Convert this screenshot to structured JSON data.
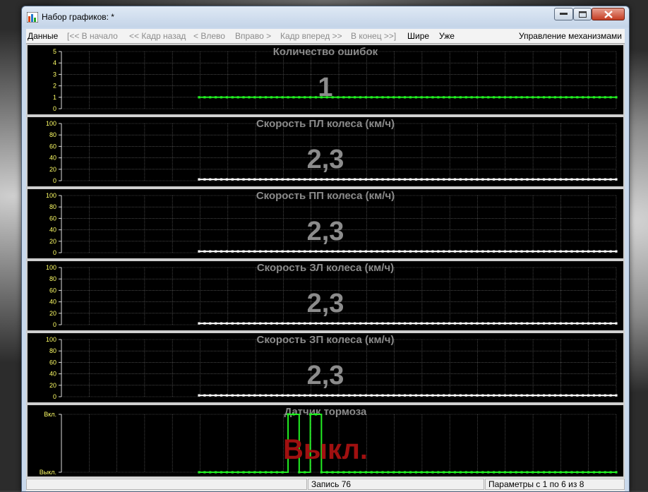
{
  "window": {
    "title": "Набор графиков: *"
  },
  "menu": {
    "items": [
      {
        "label": "Данные",
        "enabled": true
      },
      {
        "label": "[<< В начало",
        "enabled": false
      },
      {
        "label": "<< Кадр назад",
        "enabled": false
      },
      {
        "label": "< Влево",
        "enabled": false
      },
      {
        "label": "Вправо >",
        "enabled": false
      },
      {
        "label": "Кадр вперед >>",
        "enabled": false
      },
      {
        "label": "В конец >>]",
        "enabled": false
      },
      {
        "label": "Шире",
        "enabled": true
      },
      {
        "label": "Уже",
        "enabled": true
      }
    ],
    "right_item": "Управление механизмами"
  },
  "colors": {
    "axis_label": "#ffff66",
    "grid": "#707070",
    "title": "#8a8a8a",
    "value": "#8c8c8c",
    "value_alert": "#a01010",
    "green": "#22ee22",
    "white": "#ffffff"
  },
  "chart_data": [
    {
      "type": "line",
      "title": "Количество ошибок",
      "current_value": "1",
      "yticks": [
        "5",
        "4",
        "3",
        "2",
        "1",
        "0"
      ],
      "ylim": [
        0,
        5
      ],
      "x": [
        0,
        1,
        2,
        3,
        4,
        5,
        6,
        7,
        8,
        9,
        10,
        11,
        12,
        13,
        14,
        15,
        16,
        17,
        18,
        19,
        20,
        21,
        22,
        23,
        24,
        25,
        26,
        27,
        28,
        29,
        30,
        31,
        32,
        33,
        34,
        35,
        36,
        37,
        38,
        39,
        40,
        41,
        42,
        43,
        44,
        45,
        46,
        47,
        48,
        49,
        50,
        51,
        52,
        53,
        54,
        55,
        56,
        57,
        58,
        59,
        60,
        61,
        62,
        63,
        64,
        65,
        66,
        67,
        68,
        69,
        70,
        71,
        72,
        73,
        74,
        75
      ],
      "series": [
        {
          "color": "#22ee22",
          "values": [
            1,
            1,
            1,
            1,
            1,
            1,
            1,
            1,
            1,
            1,
            1,
            1,
            1,
            1,
            1,
            1,
            1,
            1,
            1,
            1,
            1,
            1,
            1,
            1,
            1,
            1,
            1,
            1,
            1,
            1,
            1,
            1,
            1,
            1,
            1,
            1,
            1,
            1,
            1,
            1,
            1,
            1,
            1,
            1,
            1,
            1,
            1,
            1,
            1,
            1,
            1,
            1,
            1,
            1,
            1,
            1,
            1,
            1,
            1,
            1,
            1,
            1,
            1,
            1,
            1,
            1,
            1,
            1,
            1,
            1,
            1,
            1,
            1,
            1,
            1,
            1
          ]
        }
      ]
    },
    {
      "type": "line",
      "title": "Скорость ПЛ колеса  (км/ч)",
      "current_value": "2,3",
      "yticks": [
        "100",
        "80",
        "60",
        "40",
        "20",
        "0"
      ],
      "ylim": [
        0,
        100
      ],
      "x": [
        0,
        1,
        2,
        3,
        4,
        5,
        6,
        7,
        8,
        9,
        10,
        11,
        12,
        13,
        14,
        15,
        16,
        17,
        18,
        19,
        20,
        21,
        22,
        23,
        24,
        25,
        26,
        27,
        28,
        29,
        30,
        31,
        32,
        33,
        34,
        35,
        36,
        37,
        38,
        39,
        40,
        41,
        42,
        43,
        44,
        45,
        46,
        47,
        48,
        49,
        50,
        51,
        52,
        53,
        54,
        55,
        56,
        57,
        58,
        59,
        60,
        61,
        62,
        63,
        64,
        65,
        66,
        67,
        68,
        69,
        70,
        71,
        72,
        73,
        74,
        75
      ],
      "series": [
        {
          "color": "#ffffff",
          "values": [
            2.3,
            2.3,
            2.3,
            2.3,
            2.3,
            2.3,
            2.3,
            2.3,
            2.3,
            2.3,
            2.3,
            2.3,
            2.3,
            2.3,
            2.3,
            2.3,
            2.3,
            2.3,
            2.3,
            2.3,
            2.3,
            2.3,
            2.3,
            2.3,
            2.3,
            2.3,
            2.3,
            2.3,
            2.3,
            2.3,
            2.3,
            2.3,
            2.3,
            2.3,
            2.3,
            2.3,
            2.3,
            2.3,
            2.3,
            2.3,
            2.3,
            2.3,
            2.3,
            2.3,
            2.3,
            2.3,
            2.3,
            2.3,
            2.3,
            2.3,
            2.3,
            2.3,
            2.3,
            2.3,
            2.3,
            2.3,
            2.3,
            2.3,
            2.3,
            2.3,
            2.3,
            2.3,
            2.3,
            2.3,
            2.3,
            2.3,
            2.3,
            2.3,
            2.3,
            2.3,
            2.3,
            2.3,
            2.3,
            2.3,
            2.3,
            2.3
          ]
        }
      ]
    },
    {
      "type": "line",
      "title": "Скорость ПП колеса  (км/ч)",
      "current_value": "2,3",
      "yticks": [
        "100",
        "80",
        "60",
        "40",
        "20",
        "0"
      ],
      "ylim": [
        0,
        100
      ],
      "x": [
        0,
        1,
        2,
        3,
        4,
        5,
        6,
        7,
        8,
        9,
        10,
        11,
        12,
        13,
        14,
        15,
        16,
        17,
        18,
        19,
        20,
        21,
        22,
        23,
        24,
        25,
        26,
        27,
        28,
        29,
        30,
        31,
        32,
        33,
        34,
        35,
        36,
        37,
        38,
        39,
        40,
        41,
        42,
        43,
        44,
        45,
        46,
        47,
        48,
        49,
        50,
        51,
        52,
        53,
        54,
        55,
        56,
        57,
        58,
        59,
        60,
        61,
        62,
        63,
        64,
        65,
        66,
        67,
        68,
        69,
        70,
        71,
        72,
        73,
        74,
        75
      ],
      "series": [
        {
          "color": "#ffffff",
          "values": [
            2.3,
            2.3,
            2.3,
            2.3,
            2.3,
            2.3,
            2.3,
            2.3,
            2.3,
            2.3,
            2.3,
            2.3,
            2.3,
            2.3,
            2.3,
            2.3,
            2.3,
            2.3,
            2.3,
            2.3,
            2.3,
            2.3,
            2.3,
            2.3,
            2.3,
            2.3,
            2.3,
            2.3,
            2.3,
            2.3,
            2.3,
            2.3,
            2.3,
            2.3,
            2.3,
            2.3,
            2.3,
            2.3,
            2.3,
            2.3,
            2.3,
            2.3,
            2.3,
            2.3,
            2.3,
            2.3,
            2.3,
            2.3,
            2.3,
            2.3,
            2.3,
            2.3,
            2.3,
            2.3,
            2.3,
            2.3,
            2.3,
            2.3,
            2.3,
            2.3,
            2.3,
            2.3,
            2.3,
            2.3,
            2.3,
            2.3,
            2.3,
            2.3,
            2.3,
            2.3,
            2.3,
            2.3,
            2.3,
            2.3,
            2.3,
            2.3
          ]
        }
      ]
    },
    {
      "type": "line",
      "title": "Скорость ЗЛ колеса  (км/ч)",
      "current_value": "2,3",
      "yticks": [
        "100",
        "80",
        "60",
        "40",
        "20",
        "0"
      ],
      "ylim": [
        0,
        100
      ],
      "x": [
        0,
        1,
        2,
        3,
        4,
        5,
        6,
        7,
        8,
        9,
        10,
        11,
        12,
        13,
        14,
        15,
        16,
        17,
        18,
        19,
        20,
        21,
        22,
        23,
        24,
        25,
        26,
        27,
        28,
        29,
        30,
        31,
        32,
        33,
        34,
        35,
        36,
        37,
        38,
        39,
        40,
        41,
        42,
        43,
        44,
        45,
        46,
        47,
        48,
        49,
        50,
        51,
        52,
        53,
        54,
        55,
        56,
        57,
        58,
        59,
        60,
        61,
        62,
        63,
        64,
        65,
        66,
        67,
        68,
        69,
        70,
        71,
        72,
        73,
        74,
        75
      ],
      "series": [
        {
          "color": "#ffffff",
          "values": [
            2.3,
            2.3,
            2.3,
            2.3,
            2.3,
            2.3,
            2.3,
            2.3,
            2.3,
            2.3,
            2.3,
            2.3,
            2.3,
            2.3,
            2.3,
            2.3,
            2.3,
            2.3,
            2.3,
            2.3,
            2.3,
            2.3,
            2.3,
            2.3,
            2.3,
            2.3,
            2.3,
            2.3,
            2.3,
            2.3,
            2.3,
            2.3,
            2.3,
            2.3,
            2.3,
            2.3,
            2.3,
            2.3,
            2.3,
            2.3,
            2.3,
            2.3,
            2.3,
            2.3,
            2.3,
            2.3,
            2.3,
            2.3,
            2.3,
            2.3,
            2.3,
            2.3,
            2.3,
            2.3,
            2.3,
            2.3,
            2.3,
            2.3,
            2.3,
            2.3,
            2.3,
            2.3,
            2.3,
            2.3,
            2.3,
            2.3,
            2.3,
            2.3,
            2.3,
            2.3,
            2.3,
            2.3,
            2.3,
            2.3,
            2.3,
            2.3
          ]
        }
      ]
    },
    {
      "type": "line",
      "title": "Скорость ЗП колеса  (км/ч)",
      "current_value": "2,3",
      "yticks": [
        "100",
        "80",
        "60",
        "40",
        "20",
        "0"
      ],
      "ylim": [
        0,
        100
      ],
      "x": [
        0,
        1,
        2,
        3,
        4,
        5,
        6,
        7,
        8,
        9,
        10,
        11,
        12,
        13,
        14,
        15,
        16,
        17,
        18,
        19,
        20,
        21,
        22,
        23,
        24,
        25,
        26,
        27,
        28,
        29,
        30,
        31,
        32,
        33,
        34,
        35,
        36,
        37,
        38,
        39,
        40,
        41,
        42,
        43,
        44,
        45,
        46,
        47,
        48,
        49,
        50,
        51,
        52,
        53,
        54,
        55,
        56,
        57,
        58,
        59,
        60,
        61,
        62,
        63,
        64,
        65,
        66,
        67,
        68,
        69,
        70,
        71,
        72,
        73,
        74,
        75
      ],
      "series": [
        {
          "color": "#ffffff",
          "values": [
            2.3,
            2.3,
            2.3,
            2.3,
            2.3,
            2.3,
            2.3,
            2.3,
            2.3,
            2.3,
            2.3,
            2.3,
            2.3,
            2.3,
            2.3,
            2.3,
            2.3,
            2.3,
            2.3,
            2.3,
            2.3,
            2.3,
            2.3,
            2.3,
            2.3,
            2.3,
            2.3,
            2.3,
            2.3,
            2.3,
            2.3,
            2.3,
            2.3,
            2.3,
            2.3,
            2.3,
            2.3,
            2.3,
            2.3,
            2.3,
            2.3,
            2.3,
            2.3,
            2.3,
            2.3,
            2.3,
            2.3,
            2.3,
            2.3,
            2.3,
            2.3,
            2.3,
            2.3,
            2.3,
            2.3,
            2.3,
            2.3,
            2.3,
            2.3,
            2.3,
            2.3,
            2.3,
            2.3,
            2.3,
            2.3,
            2.3,
            2.3,
            2.3,
            2.3,
            2.3,
            2.3,
            2.3,
            2.3,
            2.3,
            2.3,
            2.3
          ]
        }
      ]
    },
    {
      "type": "line",
      "step": true,
      "title": "Датчик тормоза",
      "current_value": "Выкл.",
      "current_value_alert": true,
      "yticks": [
        "Вкл.",
        "Выкл."
      ],
      "ylim": [
        0,
        1
      ],
      "x": [
        0,
        1,
        2,
        3,
        4,
        5,
        6,
        7,
        8,
        9,
        10,
        11,
        12,
        13,
        14,
        15,
        16,
        17,
        18,
        19,
        20,
        21,
        22,
        23,
        24,
        25,
        26,
        27,
        28,
        29,
        30,
        31,
        32,
        33,
        34,
        35,
        36,
        37,
        38,
        39,
        40,
        41,
        42,
        43,
        44,
        45,
        46,
        47,
        48,
        49,
        50,
        51,
        52,
        53,
        54,
        55,
        56,
        57,
        58,
        59,
        60,
        61,
        62,
        63,
        64,
        65,
        66,
        67,
        68,
        69,
        70,
        71,
        72,
        73,
        74,
        75
      ],
      "series": [
        {
          "color": "#22ee22",
          "values": [
            0,
            0,
            0,
            0,
            0,
            0,
            0,
            0,
            0,
            0,
            0,
            0,
            0,
            0,
            0,
            0,
            1,
            1,
            0,
            0,
            1,
            1,
            0,
            0,
            0,
            0,
            0,
            0,
            0,
            0,
            0,
            0,
            0,
            0,
            0,
            0,
            0,
            0,
            0,
            0,
            0,
            0,
            0,
            0,
            0,
            0,
            0,
            0,
            0,
            0,
            0,
            0,
            0,
            0,
            0,
            0,
            0,
            0,
            0,
            0,
            0,
            0,
            0,
            0,
            0,
            0,
            0,
            0,
            0,
            0,
            0,
            0,
            0,
            0,
            0,
            0
          ]
        }
      ]
    }
  ],
  "status": {
    "record": "Запись 76",
    "params": "Параметры с 1 по 6 из 8"
  }
}
